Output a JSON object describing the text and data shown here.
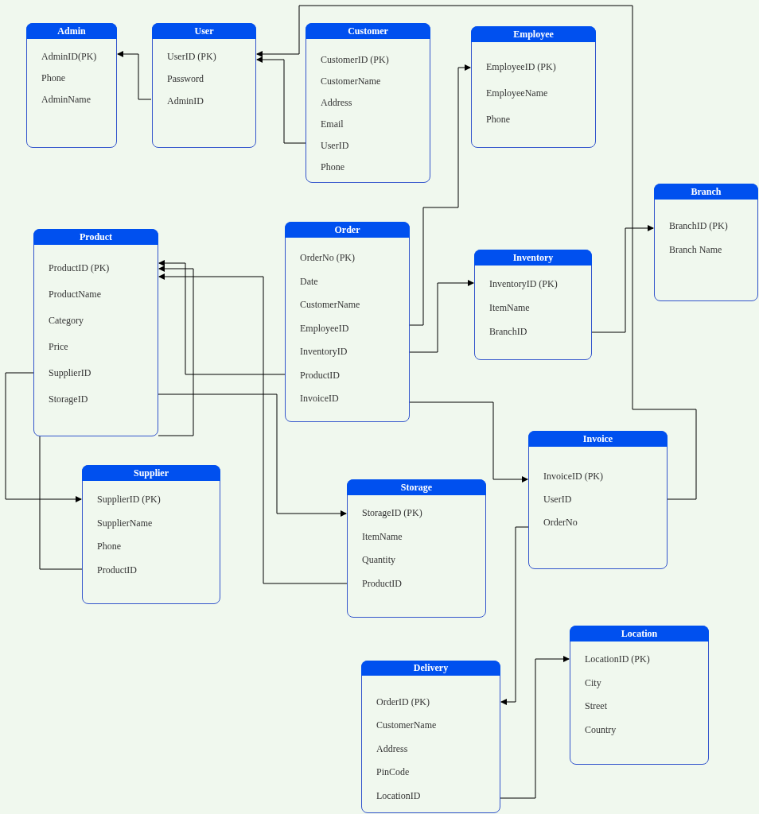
{
  "entities": [
    {
      "name": "Admin",
      "fields": [
        "AdminID(PK)",
        "Phone",
        "AdminName"
      ]
    },
    {
      "name": "User",
      "fields": [
        "UserID (PK)",
        "Password",
        "AdminID"
      ]
    },
    {
      "name": "Customer",
      "fields": [
        "CustomerID (PK)",
        "CustomerName",
        "Address",
        "Email",
        "UserID",
        "Phone"
      ]
    },
    {
      "name": "Employee",
      "fields": [
        "EmployeeID (PK)",
        "EmployeeName",
        "Phone"
      ]
    },
    {
      "name": "Branch",
      "fields": [
        "BranchID (PK)",
        "Branch Name"
      ]
    },
    {
      "name": "Product",
      "fields": [
        "ProductID (PK)",
        "ProductName",
        "Category",
        "Price",
        "SupplierID",
        "StorageID"
      ]
    },
    {
      "name": "Order",
      "fields": [
        "OrderNo (PK)",
        "Date",
        "CustomerName",
        "EmployeeID",
        "InventoryID",
        "ProductID",
        "InvoiceID"
      ]
    },
    {
      "name": "Inventory",
      "fields": [
        "InventoryID (PK)",
        "ItemName",
        "BranchID"
      ]
    },
    {
      "name": "Invoice",
      "fields": [
        "InvoiceID (PK)",
        "UserID",
        "OrderNo"
      ]
    },
    {
      "name": "Supplier",
      "fields": [
        "SupplierID (PK)",
        "SupplierName",
        "Phone",
        "ProductID"
      ]
    },
    {
      "name": "Storage",
      "fields": [
        "StorageID (PK)",
        "ItemName",
        "Quantity",
        "ProductID"
      ]
    },
    {
      "name": "Location",
      "fields": [
        "LocationID (PK)",
        "City",
        "Street",
        "Country"
      ]
    },
    {
      "name": "Delivery",
      "fields": [
        "OrderID (PK)",
        "CustomerName",
        "Address",
        "PinCode",
        "LocationID"
      ]
    }
  ]
}
